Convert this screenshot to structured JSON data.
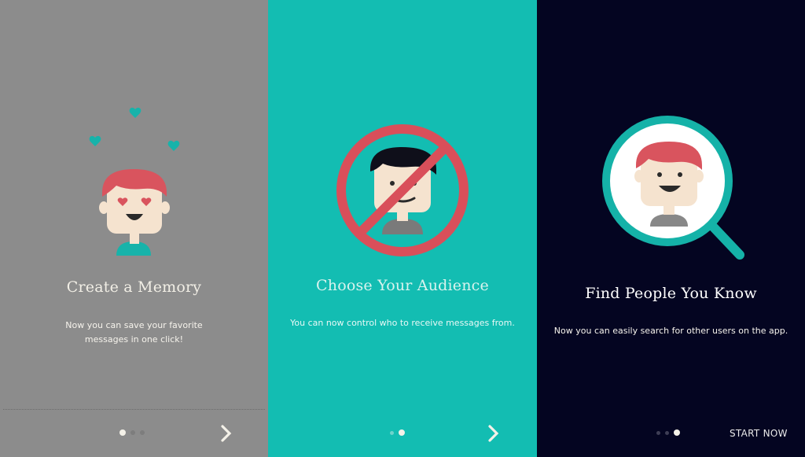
{
  "panels": [
    {
      "title": "Create a Memory",
      "description": "Now you can save your favorite messages in one click!",
      "illustration": "heart-eyes-person-icon",
      "pager": {
        "total": 3,
        "active": 1
      },
      "action": {
        "type": "next",
        "icon": "chevron-right-icon"
      }
    },
    {
      "title": "Choose Your Audience",
      "description": "You can now control who to receive messages from.",
      "illustration": "blocked-person-icon",
      "pager": {
        "total": 2,
        "active": 2
      },
      "action": {
        "type": "next",
        "icon": "chevron-right-icon"
      }
    },
    {
      "title": "Find People You Know",
      "description": "Now you can easily search for other users on the app.",
      "illustration": "magnifier-person-icon",
      "pager": {
        "total": 3,
        "active": 3
      },
      "action": {
        "type": "start",
        "label": "START NOW"
      }
    }
  ],
  "colors": {
    "panel1_bg": "#8c8c8c",
    "panel2_bg": "#13bdb2",
    "panel3_bg": "#040521",
    "accent_red": "#d9545e",
    "accent_teal": "#13bdb2",
    "skin": "#f5e3cf"
  }
}
